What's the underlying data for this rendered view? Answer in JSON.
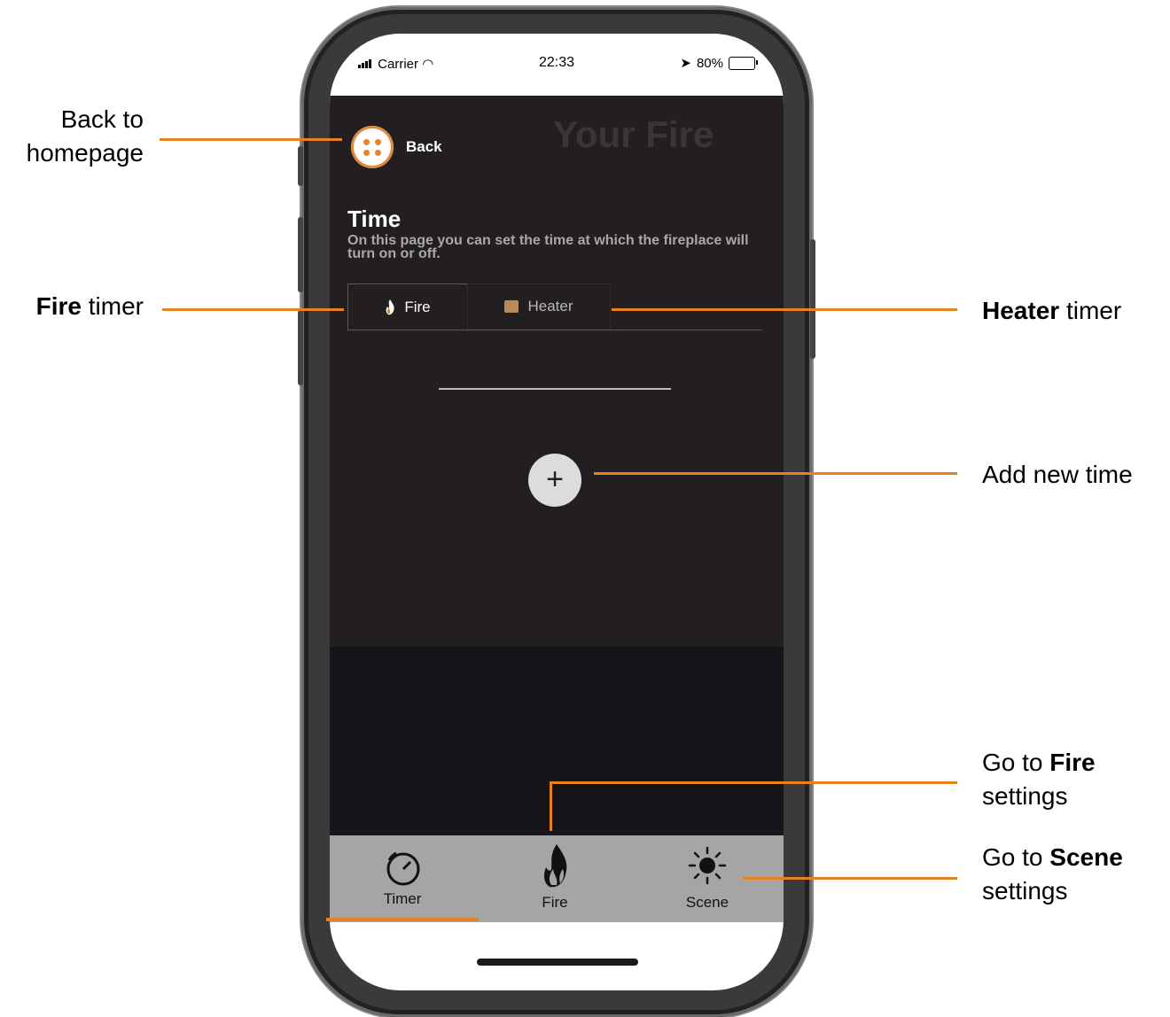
{
  "status_bar": {
    "carrier": "Carrier",
    "time": "22:33",
    "battery": "80%"
  },
  "app": {
    "watermark": "Your Fire",
    "back_label": "Back",
    "title": "Time",
    "description": "On this page you can set the time at which the fireplace will turn on or off.",
    "tabs": [
      {
        "label": "Fire",
        "active": true,
        "icon": "flame-icon"
      },
      {
        "label": "Heater",
        "active": false,
        "icon": "heater-icon"
      }
    ],
    "add_button": "+"
  },
  "bottom_tabs": [
    {
      "label": "Timer",
      "icon": "timer-icon",
      "active": true
    },
    {
      "label": "Fire",
      "icon": "flame-icon",
      "active": false
    },
    {
      "label": "Scene",
      "icon": "sun-icon",
      "active": false
    }
  ],
  "annotations": {
    "back": {
      "line1": "Back to",
      "line2": "homepage"
    },
    "fire_timer": {
      "bold": "Fire",
      "rest": " timer"
    },
    "heater_timer": {
      "bold": "Heater",
      "rest": " timer"
    },
    "add_time": "Add new time",
    "go_fire": {
      "pre": "Go to ",
      "bold": "Fire",
      "line2": "settings"
    },
    "go_scene": {
      "pre": "Go to ",
      "bold": "Scene",
      "line2": "settings"
    }
  },
  "colors": {
    "accent": "#e8821e",
    "app_bg": "#231f20",
    "tabbar_bg": "#a5a5a5"
  }
}
